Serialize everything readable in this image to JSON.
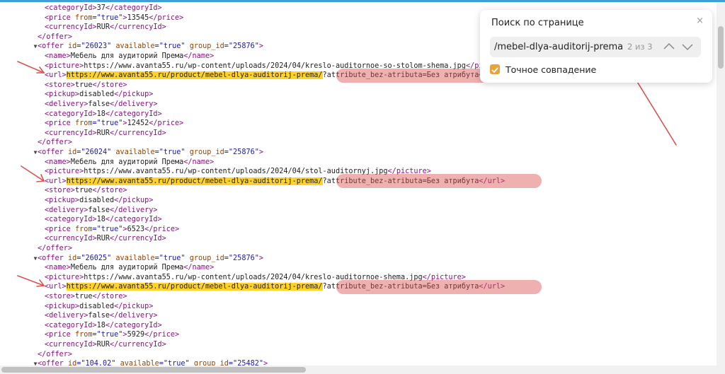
{
  "xml_lines": [
    {
      "indent": 3,
      "segs": [
        {
          "t": "<categoryId>",
          "c": "tag"
        },
        {
          "t": "37"
        },
        {
          "t": "</categoryId>",
          "c": "tag"
        }
      ]
    },
    {
      "indent": 3,
      "segs": [
        {
          "t": "<price ",
          "c": "tag"
        },
        {
          "t": "from",
          "c": "an"
        },
        {
          "t": "=\"true\"",
          "c": "av"
        },
        {
          "t": ">",
          "c": "tag"
        },
        {
          "t": "13545"
        },
        {
          "t": "</price>",
          "c": "tag"
        }
      ]
    },
    {
      "indent": 3,
      "segs": [
        {
          "t": "<currencyId>",
          "c": "tag"
        },
        {
          "t": "RUR"
        },
        {
          "t": "</currencyId>",
          "c": "tag"
        }
      ]
    },
    {
      "indent": 2,
      "segs": [
        {
          "t": "</offer>",
          "c": "tag"
        }
      ]
    },
    {
      "indent": 2,
      "tri": "▼",
      "segs": [
        {
          "t": "<offer ",
          "c": "tag"
        },
        {
          "t": "id",
          "c": "an"
        },
        {
          "t": "=\"26023\" ",
          "c": "av"
        },
        {
          "t": "available",
          "c": "an"
        },
        {
          "t": "=\"true\" ",
          "c": "av"
        },
        {
          "t": "group_id",
          "c": "an"
        },
        {
          "t": "=\"25876\"",
          "c": "av"
        },
        {
          "t": ">",
          "c": "tag"
        }
      ]
    },
    {
      "indent": 3,
      "segs": [
        {
          "t": "<name>",
          "c": "tag"
        },
        {
          "t": "Мебель для аудиторий Према"
        },
        {
          "t": "</name>",
          "c": "tag"
        }
      ]
    },
    {
      "indent": 3,
      "segs": [
        {
          "t": "<picture>",
          "c": "tag"
        },
        {
          "t": "https://www.avanta55.ru/wp-content/uploads/2024/04/kreslo-auditornoe-so-stolom-shema.jpg"
        },
        {
          "t": "</picture>",
          "c": "tag"
        }
      ]
    },
    {
      "indent": 3,
      "segs": [
        {
          "t": "<url>",
          "c": "tag"
        },
        {
          "t": "https://www.avanta55.ru/product/mebel-dlya-auditorij-prema/",
          "c": "hl"
        },
        {
          "t": "?attribute_bez-atributa=Без атрибута"
        },
        {
          "t": "</url>",
          "c": "tag"
        }
      ]
    },
    {
      "indent": 3,
      "segs": [
        {
          "t": "<store>",
          "c": "tag"
        },
        {
          "t": "true"
        },
        {
          "t": "</store>",
          "c": "tag"
        }
      ]
    },
    {
      "indent": 3,
      "segs": [
        {
          "t": "<pickup>",
          "c": "tag"
        },
        {
          "t": "disabled"
        },
        {
          "t": "</pickup>",
          "c": "tag"
        }
      ]
    },
    {
      "indent": 3,
      "segs": [
        {
          "t": "<delivery>",
          "c": "tag"
        },
        {
          "t": "false"
        },
        {
          "t": "</delivery>",
          "c": "tag"
        }
      ]
    },
    {
      "indent": 3,
      "segs": [
        {
          "t": "<categoryId>",
          "c": "tag"
        },
        {
          "t": "18"
        },
        {
          "t": "</categoryId>",
          "c": "tag"
        }
      ]
    },
    {
      "indent": 3,
      "segs": [
        {
          "t": "<price ",
          "c": "tag"
        },
        {
          "t": "from",
          "c": "an"
        },
        {
          "t": "=\"true\"",
          "c": "av"
        },
        {
          "t": ">",
          "c": "tag"
        },
        {
          "t": "12452"
        },
        {
          "t": "</price>",
          "c": "tag"
        }
      ]
    },
    {
      "indent": 3,
      "segs": [
        {
          "t": "<currencyId>",
          "c": "tag"
        },
        {
          "t": "RUR"
        },
        {
          "t": "</currencyId>",
          "c": "tag"
        }
      ]
    },
    {
      "indent": 2,
      "segs": [
        {
          "t": "</offer>",
          "c": "tag"
        }
      ]
    },
    {
      "indent": 2,
      "tri": "▼",
      "segs": [
        {
          "t": "<offer ",
          "c": "tag"
        },
        {
          "t": "id",
          "c": "an"
        },
        {
          "t": "=\"26024\" ",
          "c": "av"
        },
        {
          "t": "available",
          "c": "an"
        },
        {
          "t": "=\"true\" ",
          "c": "av"
        },
        {
          "t": "group_id",
          "c": "an"
        },
        {
          "t": "=\"25876\"",
          "c": "av"
        },
        {
          "t": ">",
          "c": "tag"
        }
      ]
    },
    {
      "indent": 3,
      "segs": [
        {
          "t": "<name>",
          "c": "tag"
        },
        {
          "t": "Мебель для аудиторий Према"
        },
        {
          "t": "</name>",
          "c": "tag"
        }
      ]
    },
    {
      "indent": 3,
      "segs": [
        {
          "t": "<picture>",
          "c": "tag"
        },
        {
          "t": "https://www.avanta55.ru/wp-content/uploads/2024/04/stol-auditornyj.jpg"
        },
        {
          "t": "</picture>",
          "c": "tag"
        }
      ]
    },
    {
      "indent": 3,
      "segs": [
        {
          "t": "<url>",
          "c": "tag"
        },
        {
          "t": "https://www.avanta55.ru/product/mebel-dlya-auditorij-prema/",
          "c": "hl"
        },
        {
          "t": "?attribute_bez-atributa=Без атрибута"
        },
        {
          "t": "</url>",
          "c": "tag"
        }
      ]
    },
    {
      "indent": 3,
      "segs": [
        {
          "t": "<store>",
          "c": "tag"
        },
        {
          "t": "true"
        },
        {
          "t": "</store>",
          "c": "tag"
        }
      ]
    },
    {
      "indent": 3,
      "segs": [
        {
          "t": "<pickup>",
          "c": "tag"
        },
        {
          "t": "disabled"
        },
        {
          "t": "</pickup>",
          "c": "tag"
        }
      ]
    },
    {
      "indent": 3,
      "segs": [
        {
          "t": "<delivery>",
          "c": "tag"
        },
        {
          "t": "false"
        },
        {
          "t": "</delivery>",
          "c": "tag"
        }
      ]
    },
    {
      "indent": 3,
      "segs": [
        {
          "t": "<categoryId>",
          "c": "tag"
        },
        {
          "t": "18"
        },
        {
          "t": "</categoryId>",
          "c": "tag"
        }
      ]
    },
    {
      "indent": 3,
      "segs": [
        {
          "t": "<price ",
          "c": "tag"
        },
        {
          "t": "from",
          "c": "an"
        },
        {
          "t": "=\"true\"",
          "c": "av"
        },
        {
          "t": ">",
          "c": "tag"
        },
        {
          "t": "6523"
        },
        {
          "t": "</price>",
          "c": "tag"
        }
      ]
    },
    {
      "indent": 3,
      "segs": [
        {
          "t": "<currencyId>",
          "c": "tag"
        },
        {
          "t": "RUR"
        },
        {
          "t": "</currencyId>",
          "c": "tag"
        }
      ]
    },
    {
      "indent": 2,
      "segs": [
        {
          "t": "</offer>",
          "c": "tag"
        }
      ]
    },
    {
      "indent": 2,
      "tri": "▼",
      "segs": [
        {
          "t": "<offer ",
          "c": "tag"
        },
        {
          "t": "id",
          "c": "an"
        },
        {
          "t": "=\"26025\" ",
          "c": "av"
        },
        {
          "t": "available",
          "c": "an"
        },
        {
          "t": "=\"true\" ",
          "c": "av"
        },
        {
          "t": "group_id",
          "c": "an"
        },
        {
          "t": "=\"25876\"",
          "c": "av"
        },
        {
          "t": ">",
          "c": "tag"
        }
      ]
    },
    {
      "indent": 3,
      "segs": [
        {
          "t": "<name>",
          "c": "tag"
        },
        {
          "t": "Мебель для аудиторий Према"
        },
        {
          "t": "</name>",
          "c": "tag"
        }
      ]
    },
    {
      "indent": 3,
      "segs": [
        {
          "t": "<picture>",
          "c": "tag"
        },
        {
          "t": "https://www.avanta55.ru/wp-content/uploads/2024/04/kreslo-auditornoe-shema.jpg"
        },
        {
          "t": "</picture>",
          "c": "tag"
        }
      ]
    },
    {
      "indent": 3,
      "segs": [
        {
          "t": "<url>",
          "c": "tag"
        },
        {
          "t": "https://www.avanta55.ru/product/mebel-dlya-auditorij-prema/",
          "c": "hl"
        },
        {
          "t": "?attribute_bez-atributa=Без атрибута"
        },
        {
          "t": "</url>",
          "c": "tag"
        }
      ]
    },
    {
      "indent": 3,
      "segs": [
        {
          "t": "<store>",
          "c": "tag"
        },
        {
          "t": "true"
        },
        {
          "t": "</store>",
          "c": "tag"
        }
      ]
    },
    {
      "indent": 3,
      "segs": [
        {
          "t": "<pickup>",
          "c": "tag"
        },
        {
          "t": "disabled"
        },
        {
          "t": "</pickup>",
          "c": "tag"
        }
      ]
    },
    {
      "indent": 3,
      "segs": [
        {
          "t": "<delivery>",
          "c": "tag"
        },
        {
          "t": "false"
        },
        {
          "t": "</delivery>",
          "c": "tag"
        }
      ]
    },
    {
      "indent": 3,
      "segs": [
        {
          "t": "<categoryId>",
          "c": "tag"
        },
        {
          "t": "18"
        },
        {
          "t": "</categoryId>",
          "c": "tag"
        }
      ]
    },
    {
      "indent": 3,
      "segs": [
        {
          "t": "<price ",
          "c": "tag"
        },
        {
          "t": "from",
          "c": "an"
        },
        {
          "t": "=\"true\"",
          "c": "av"
        },
        {
          "t": ">",
          "c": "tag"
        },
        {
          "t": "5929"
        },
        {
          "t": "</price>",
          "c": "tag"
        }
      ]
    },
    {
      "indent": 3,
      "segs": [
        {
          "t": "<currencyId>",
          "c": "tag"
        },
        {
          "t": "RUR"
        },
        {
          "t": "</currencyId>",
          "c": "tag"
        }
      ]
    },
    {
      "indent": 2,
      "segs": [
        {
          "t": "</offer>",
          "c": "tag"
        }
      ]
    },
    {
      "indent": 2,
      "tri": "▼",
      "segs": [
        {
          "t": "<offer ",
          "c": "tag"
        },
        {
          "t": "id",
          "c": "an"
        },
        {
          "t": "=\"104.02\" ",
          "c": "av"
        },
        {
          "t": "available",
          "c": "an"
        },
        {
          "t": "=\"true\" ",
          "c": "av"
        },
        {
          "t": "group_id",
          "c": "an"
        },
        {
          "t": "=\"25482\"",
          "c": "av"
        },
        {
          "t": ">",
          "c": "tag"
        }
      ]
    }
  ],
  "find_bar": {
    "title": "Поиск по странице",
    "close_glyph": "×",
    "query": "/mebel-dlya-auditorij-prema/",
    "match_count": "2 из 3",
    "prev_icon": "chevron-up-icon",
    "next_icon": "chevron-down-icon",
    "exact_match_label": "Точное совпадение",
    "exact_match_checked": true
  },
  "colors": {
    "tag": "#881280",
    "attr_name": "#994500",
    "attr_value": "#1a1aa6",
    "search_highlight": "#ffd229",
    "annotation": "#d9534f",
    "checkbox": "#e8a33b"
  }
}
